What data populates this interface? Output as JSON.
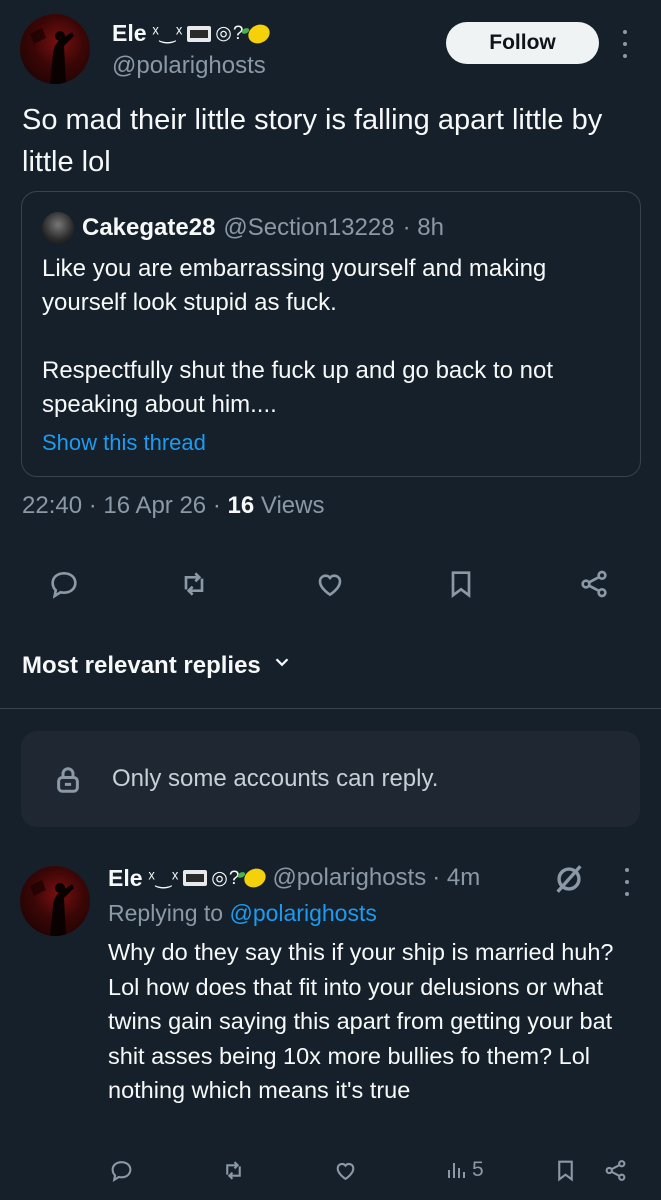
{
  "post": {
    "author_name": "Ele",
    "author_emojis": "ˣ‿ˣ",
    "author_emojis_tail": "◎?",
    "author_handle": "@polarighosts",
    "follow_label": "Follow",
    "text": "So mad their little story is falling apart little by little lol",
    "time": "22:40",
    "sep1": "·",
    "date": "16 Apr 26",
    "sep2": "·",
    "views_count": "16",
    "views_label": "Views"
  },
  "quote": {
    "name": "Cakegate28",
    "handle": "@Section13228",
    "age": "· 8h",
    "paragraph1": "Like you are embarrassing yourself and making yourself look stupid as fuck.",
    "paragraph2": "Respectfully shut the fuck up and go back to not speaking about him....",
    "show_thread": "Show this thread"
  },
  "actions": [
    "reply-icon",
    "repost-icon",
    "like-icon",
    "bookmark-icon",
    "share-icon"
  ],
  "replies": {
    "sort_label": "Most relevant replies",
    "limit_notice": "Only some accounts can reply."
  },
  "reply": {
    "author_name": "Ele",
    "author_emojis": "ˣ‿ˣ",
    "author_emojis_tail": "◎?",
    "handle": "@polarighosts",
    "age": "· 4m",
    "replying_prefix": "Replying to",
    "replying_to": "@polarighosts",
    "text": "Why do they say this if your ship is married huh? Lol how does that fit into your delusions or what twins gain saying this apart from getting your bat shit asses being 10x more bullies fo them? Lol nothing which means it's true",
    "views": "5"
  },
  "colors": {
    "background": "#15202b",
    "text": "#f7f9f9",
    "muted": "#8b98a5",
    "accent": "#1d9bf0",
    "border": "#38444d"
  }
}
